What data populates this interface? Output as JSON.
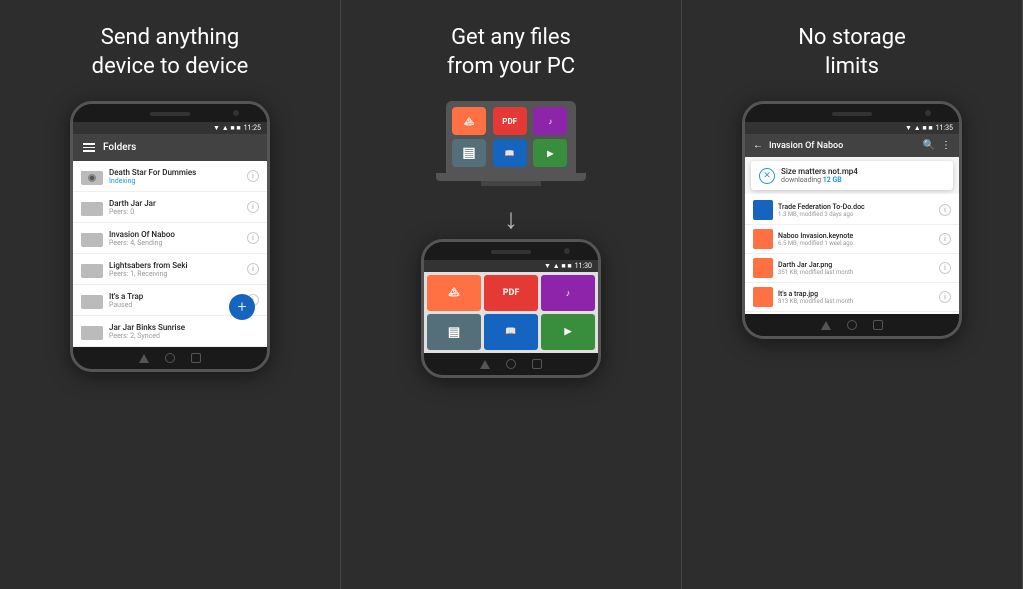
{
  "panels": [
    {
      "title": "Send anything\ndevice to device",
      "phone": {
        "status_time": "11:25",
        "header": {
          "title": "Folders"
        },
        "folders": [
          {
            "name": "Death Star For Dummies",
            "sub": "Indexing",
            "sub_class": "indexing-text",
            "has_special_icon": true
          },
          {
            "name": "Darth Jar Jar",
            "sub": "Peers: 0",
            "sub_class": ""
          },
          {
            "name": "Invasion Of Naboo",
            "sub": "Peers: 4, Sending",
            "sub_class": ""
          },
          {
            "name": "Lightsabers from Seki",
            "sub": "Peers: 1, Receiving",
            "sub_class": ""
          },
          {
            "name": "It's a Trap",
            "sub": "Paused",
            "sub_class": ""
          },
          {
            "name": "Jar Jar Binks Sunrise",
            "sub": "Peers: 2, Synced",
            "sub_class": ""
          }
        ],
        "fab_label": "+"
      }
    },
    {
      "title": "Get any files\nfrom your PC",
      "laptop": {
        "tiles": [
          {
            "label": "🏔",
            "color": "#FF7043"
          },
          {
            "label": "PDF",
            "color": "#E53935"
          },
          {
            "label": "♪",
            "color": "#8E24AA"
          },
          {
            "label": "▓",
            "color": "#546E7A"
          },
          {
            "label": "📖",
            "color": "#1565C0"
          },
          {
            "label": "▶",
            "color": "#388E3C"
          }
        ]
      },
      "phone": {
        "status_time": "11:30",
        "tiles": [
          {
            "label": "🏔",
            "color": "#FF7043"
          },
          {
            "label": "PDF",
            "color": "#E53935"
          },
          {
            "label": "♪",
            "color": "#8E24AA"
          },
          {
            "label": "▓",
            "color": "#546E7A"
          },
          {
            "label": "📖",
            "color": "#1565C0"
          },
          {
            "label": "▶",
            "color": "#388E3C"
          }
        ]
      }
    },
    {
      "title": "No storage\nlimits",
      "phone": {
        "status_time": "11:35",
        "header": {
          "title": "Invasion Of Naboo"
        },
        "download": {
          "filename": "Size matters not.mp4",
          "status": "downloading",
          "size": "12 GB"
        },
        "files": [
          {
            "name": "Trade Federation To-Do.doc",
            "meta": "1.3 MB, modified 3 days ago",
            "color": "#1565C0"
          },
          {
            "name": "Naboo Invasion.keynote",
            "meta": "6.5 MB, modified 1 weel ago",
            "color": "#FF7043"
          },
          {
            "name": "Darth Jar Jar.png",
            "meta": "351 KB, modified last month",
            "color": "#FF7043"
          },
          {
            "name": "It's a trap.jpg",
            "meta": "813 KB, modified last month",
            "color": "#FF7043"
          }
        ]
      }
    }
  ]
}
